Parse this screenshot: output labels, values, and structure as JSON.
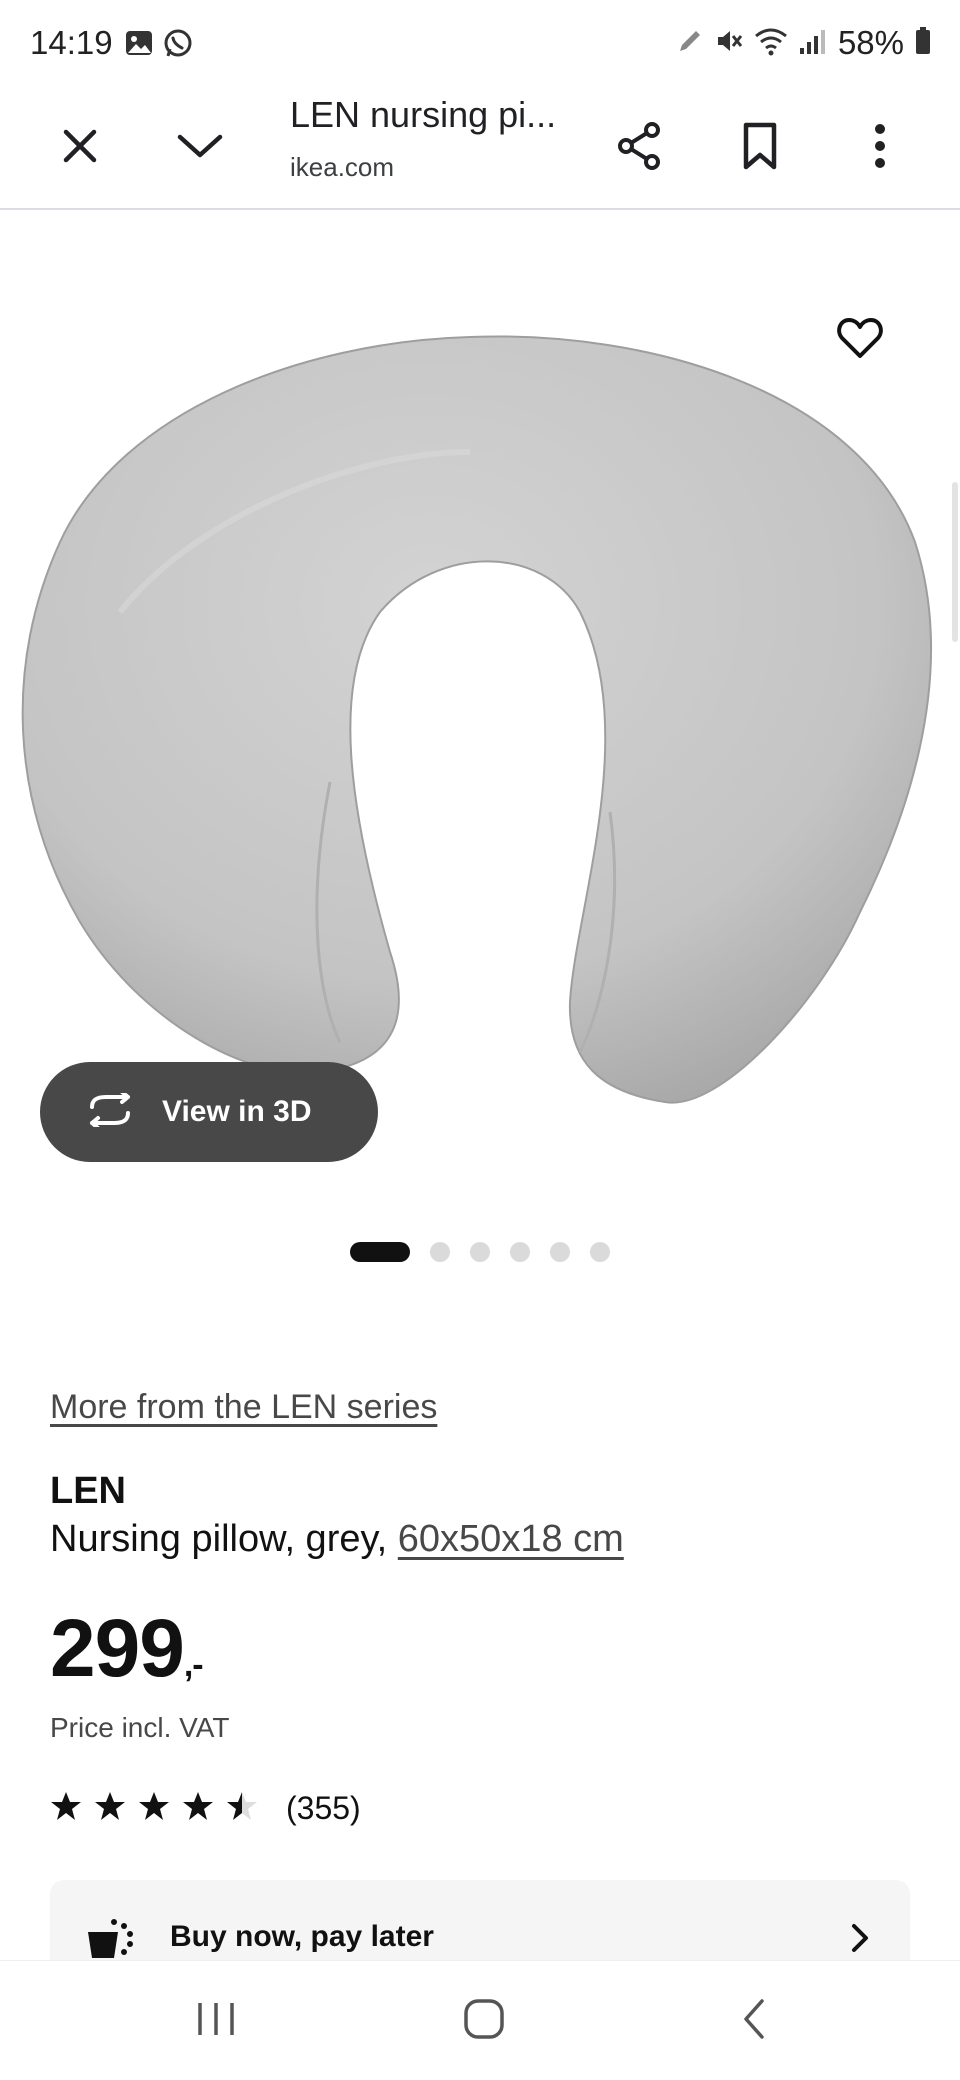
{
  "status_bar": {
    "time": "14:19",
    "battery_percent": "58%",
    "icons": [
      "gallery-icon",
      "whatsapp-icon",
      "pen-icon",
      "mute-icon",
      "wifi-icon",
      "signal-icon",
      "battery-icon"
    ]
  },
  "browser": {
    "page_title": "LEN nursing pi...",
    "domain": "ikea.com",
    "actions": [
      "close-icon",
      "chevron-down-icon",
      "share-icon",
      "bookmark-icon",
      "more-vert-icon"
    ]
  },
  "hero": {
    "view_3d_label": "View in 3D",
    "carousel_total": 6,
    "carousel_active": 1
  },
  "product": {
    "series_link": "More from the LEN series",
    "name": "LEN",
    "description": "Nursing pillow, grey, ",
    "size_link": "60x50x18 cm",
    "price_main": "299",
    "price_suffix": ",-",
    "price_note": "Price incl. VAT",
    "rating_value": 4.5,
    "rating_count": "(355)",
    "bnpl_label": "Buy now, pay later"
  },
  "colors": {
    "view3d_bg": "#484848",
    "pillow": "#c7c7c7",
    "text_primary": "#111111",
    "text_secondary": "#484848"
  },
  "nav": [
    "recents-icon",
    "home-icon",
    "back-icon"
  ]
}
